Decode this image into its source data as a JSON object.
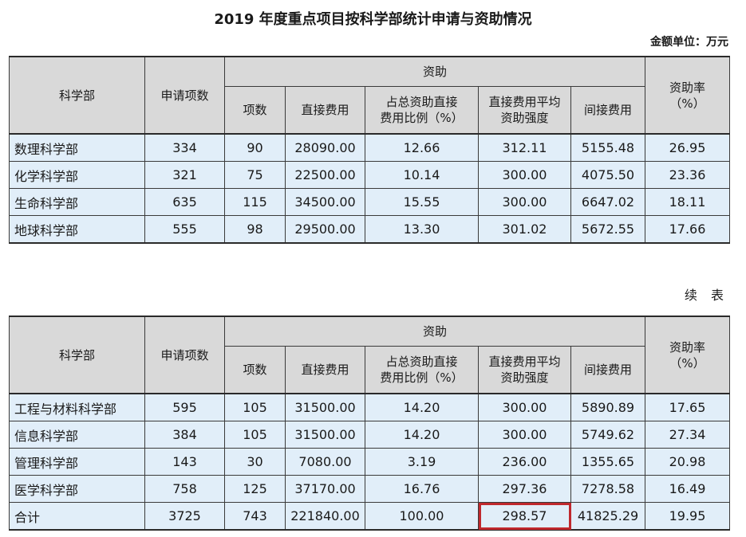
{
  "title": "2019 年度重点项目按科学部统计申请与资助情况",
  "unit": "金额单位：万元",
  "continued": "续 表",
  "headers": {
    "dept": "科学部",
    "applications": "申请项数",
    "funding": "资助",
    "count": "项数",
    "direct": "直接费用",
    "ratio_line1": "占总资助直接",
    "ratio_line2": "费用比例（%）",
    "avg_line1": "直接费用平均",
    "avg_line2": "资助强度",
    "indirect": "间接费用",
    "rate_line1": "资助率",
    "rate_line2": "（%）"
  },
  "table1": [
    {
      "dept": "数理科学部",
      "apps": "334",
      "count": "90",
      "direct": "28090.00",
      "ratio": "12.66",
      "avg": "312.11",
      "indirect": "5155.48",
      "rate": "26.95"
    },
    {
      "dept": "化学科学部",
      "apps": "321",
      "count": "75",
      "direct": "22500.00",
      "ratio": "10.14",
      "avg": "300.00",
      "indirect": "4075.50",
      "rate": "23.36"
    },
    {
      "dept": "生命科学部",
      "apps": "635",
      "count": "115",
      "direct": "34500.00",
      "ratio": "15.55",
      "avg": "300.00",
      "indirect": "6647.02",
      "rate": "18.11"
    },
    {
      "dept": "地球科学部",
      "apps": "555",
      "count": "98",
      "direct": "29500.00",
      "ratio": "13.30",
      "avg": "301.02",
      "indirect": "5672.55",
      "rate": "17.66"
    }
  ],
  "table2": [
    {
      "dept": "工程与材料科学部",
      "apps": "595",
      "count": "105",
      "direct": "31500.00",
      "ratio": "14.20",
      "avg": "300.00",
      "indirect": "5890.89",
      "rate": "17.65"
    },
    {
      "dept": "信息科学部",
      "apps": "384",
      "count": "105",
      "direct": "31500.00",
      "ratio": "14.20",
      "avg": "300.00",
      "indirect": "5749.62",
      "rate": "27.34"
    },
    {
      "dept": "管理科学部",
      "apps": "143",
      "count": "30",
      "direct": "7080.00",
      "ratio": "3.19",
      "avg": "236.00",
      "indirect": "1355.65",
      "rate": "20.98"
    },
    {
      "dept": "医学科学部",
      "apps": "758",
      "count": "125",
      "direct": "37170.00",
      "ratio": "16.76",
      "avg": "297.36",
      "indirect": "7278.58",
      "rate": "16.49"
    },
    {
      "dept": "合计",
      "apps": "3725",
      "count": "743",
      "direct": "221840.00",
      "ratio": "100.00",
      "avg": "298.57",
      "indirect": "41825.29",
      "rate": "19.95"
    }
  ],
  "highlight_color": "#c0282d"
}
